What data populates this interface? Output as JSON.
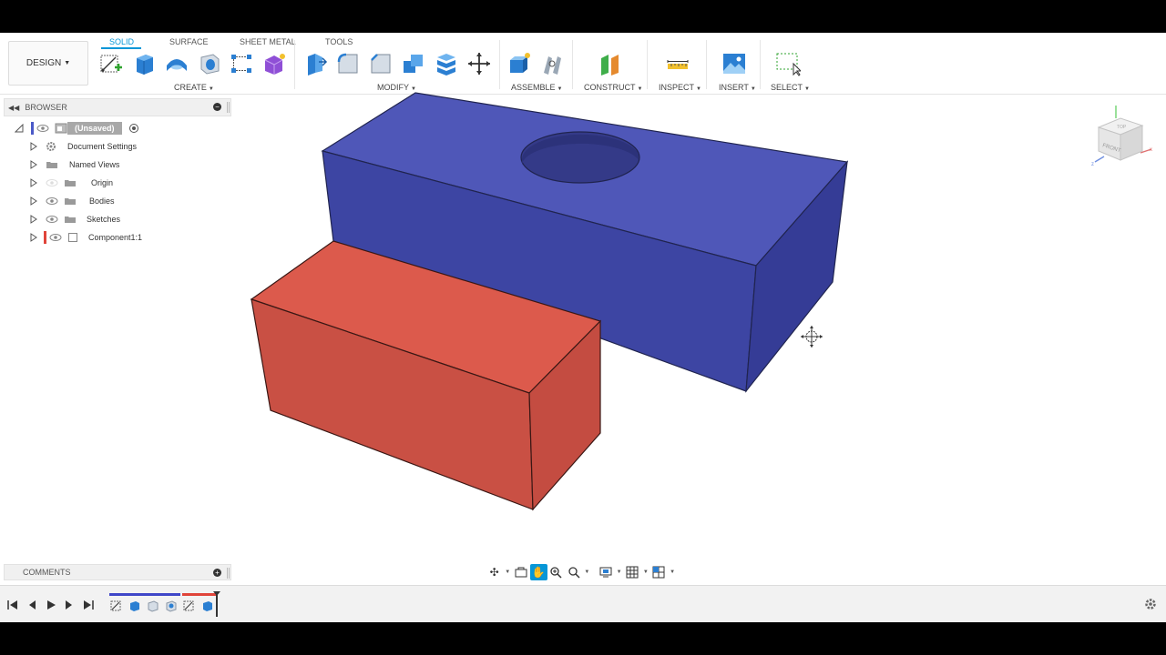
{
  "workspace": {
    "label": "DESIGN"
  },
  "tabs": [
    {
      "label": "SOLID",
      "active": true
    },
    {
      "label": "SURFACE",
      "active": false
    },
    {
      "label": "SHEET METAL",
      "active": false
    },
    {
      "label": "TOOLS",
      "active": false
    }
  ],
  "groups": {
    "create": "CREATE",
    "modify": "MODIFY",
    "assemble": "ASSEMBLE",
    "construct": "CONSTRUCT",
    "inspect": "INSPECT",
    "insert": "INSERT",
    "select": "SELECT"
  },
  "browser": {
    "title": "BROWSER",
    "root": "(Unsaved)",
    "items": [
      {
        "label": "Document Settings",
        "icon": "gear-icon"
      },
      {
        "label": "Named Views",
        "icon": "folder-icon"
      },
      {
        "label": "Origin",
        "icon": "folder-icon"
      },
      {
        "label": "Bodies",
        "icon": "folder-icon"
      },
      {
        "label": "Sketches",
        "icon": "folder-icon"
      },
      {
        "label": "Component1:1",
        "icon": "component-icon"
      }
    ]
  },
  "comments": {
    "title": "COMMENTS"
  },
  "viewcube": {
    "top": "TOP",
    "front": "FRONT"
  },
  "colors": {
    "accent": "#0696d7",
    "blue_body": "#3f47a8",
    "red_body": "#d9574a",
    "component_marker": "#e0443a"
  }
}
